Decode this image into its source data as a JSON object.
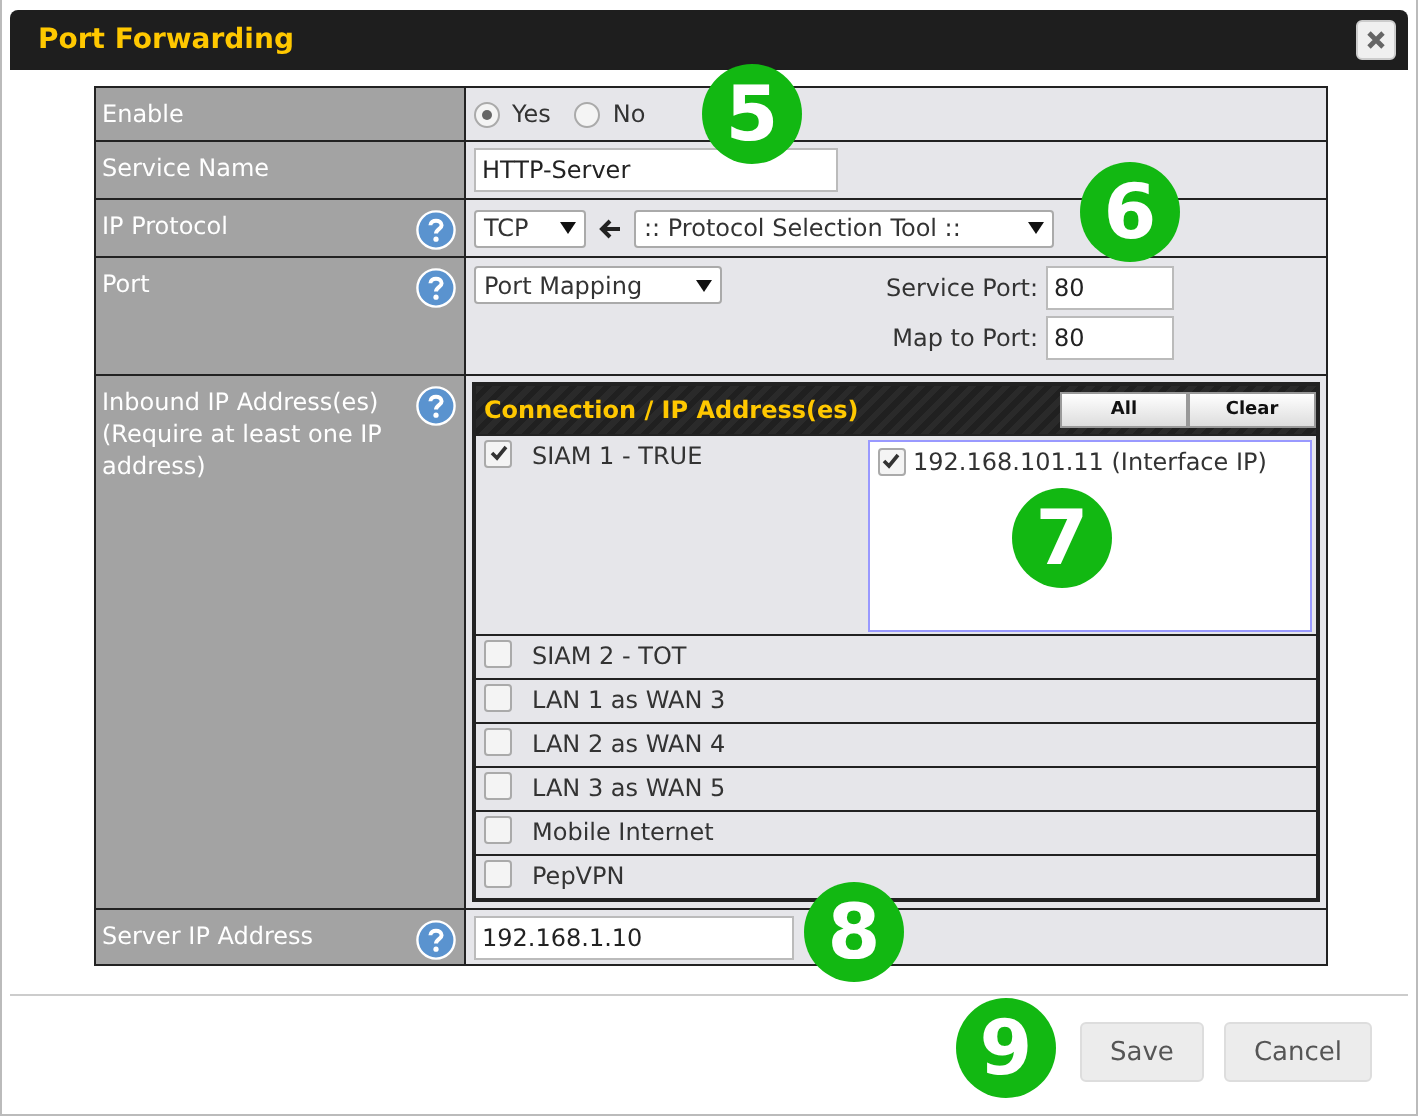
{
  "dialog": {
    "title": "Port Forwarding"
  },
  "enable": {
    "label": "Enable",
    "options": [
      {
        "label": "Yes",
        "selected": true
      },
      {
        "label": "No",
        "selected": false
      }
    ]
  },
  "service_name": {
    "label": "Service Name",
    "value": "HTTP-Server"
  },
  "ip_protocol": {
    "label": "IP Protocol",
    "value": "TCP",
    "tool": ":: Protocol Selection Tool ::"
  },
  "port": {
    "label": "Port",
    "value": "Port Mapping",
    "fields": [
      {
        "label": "Service Port:",
        "value": "80"
      },
      {
        "label": "Map to Port:",
        "value": "80"
      }
    ]
  },
  "inbound": {
    "label": "Inbound IP Address(es)",
    "note": "(Require at least one IP address)",
    "header": "Connection / IP Address(es)",
    "buttons": [
      "All",
      "Clear"
    ],
    "connections": [
      {
        "name": "SIAM 1 - TRUE",
        "checked": true,
        "addresses": [
          {
            "label": "192.168.101.11 (Interface IP)",
            "checked": true
          }
        ]
      },
      {
        "name": "SIAM 2 - TOT",
        "checked": false
      },
      {
        "name": "LAN 1 as WAN 3",
        "checked": false
      },
      {
        "name": "LAN 2 as WAN 4",
        "checked": false
      },
      {
        "name": "LAN 3 as WAN 5",
        "checked": false
      },
      {
        "name": "Mobile Internet",
        "checked": false
      },
      {
        "name": "PepVPN",
        "checked": false
      }
    ]
  },
  "server_ip": {
    "label": "Server IP Address",
    "value": "192.168.1.10"
  },
  "buttons": [
    "Save",
    "Cancel"
  ],
  "callouts": [
    "5",
    "6",
    "7",
    "8",
    "9"
  ]
}
